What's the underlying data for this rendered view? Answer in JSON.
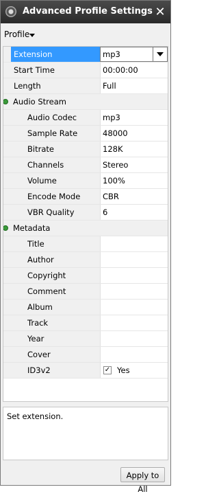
{
  "window": {
    "title": "Advanced Profile Settings"
  },
  "profile_menu": {
    "label": "Profile"
  },
  "properties": [
    {
      "kind": "prop",
      "indent": 1,
      "name": "Extension",
      "value": "mp3",
      "control": "combo",
      "selected": true
    },
    {
      "kind": "prop",
      "indent": 1,
      "name": "Start Time",
      "value": "00:00:00"
    },
    {
      "kind": "prop",
      "indent": 1,
      "name": "Length",
      "value": "Full"
    },
    {
      "kind": "category",
      "name": "Audio Stream"
    },
    {
      "kind": "prop",
      "indent": 2,
      "name": "Audio Codec",
      "value": "mp3"
    },
    {
      "kind": "prop",
      "indent": 2,
      "name": "Sample Rate",
      "value": "48000"
    },
    {
      "kind": "prop",
      "indent": 2,
      "name": "Bitrate",
      "value": "128K"
    },
    {
      "kind": "prop",
      "indent": 2,
      "name": "Channels",
      "value": "Stereo"
    },
    {
      "kind": "prop",
      "indent": 2,
      "name": "Volume",
      "value": "100%"
    },
    {
      "kind": "prop",
      "indent": 2,
      "name": "Encode Mode",
      "value": "CBR"
    },
    {
      "kind": "prop",
      "indent": 2,
      "name": "VBR Quality",
      "value": "6"
    },
    {
      "kind": "category",
      "name": "Metadata"
    },
    {
      "kind": "prop",
      "indent": 2,
      "name": "Title",
      "value": ""
    },
    {
      "kind": "prop",
      "indent": 2,
      "name": "Author",
      "value": ""
    },
    {
      "kind": "prop",
      "indent": 2,
      "name": "Copyright",
      "value": ""
    },
    {
      "kind": "prop",
      "indent": 2,
      "name": "Comment",
      "value": ""
    },
    {
      "kind": "prop",
      "indent": 2,
      "name": "Album",
      "value": ""
    },
    {
      "kind": "prop",
      "indent": 2,
      "name": "Track",
      "value": ""
    },
    {
      "kind": "prop",
      "indent": 2,
      "name": "Year",
      "value": ""
    },
    {
      "kind": "prop",
      "indent": 2,
      "name": "Cover",
      "value": ""
    },
    {
      "kind": "prop",
      "indent": 2,
      "name": "ID3v2",
      "value": "Yes",
      "control": "checkbox",
      "checked": true
    }
  ],
  "description": {
    "text": "Set extension."
  },
  "apply_button": {
    "label": "Apply to All"
  }
}
